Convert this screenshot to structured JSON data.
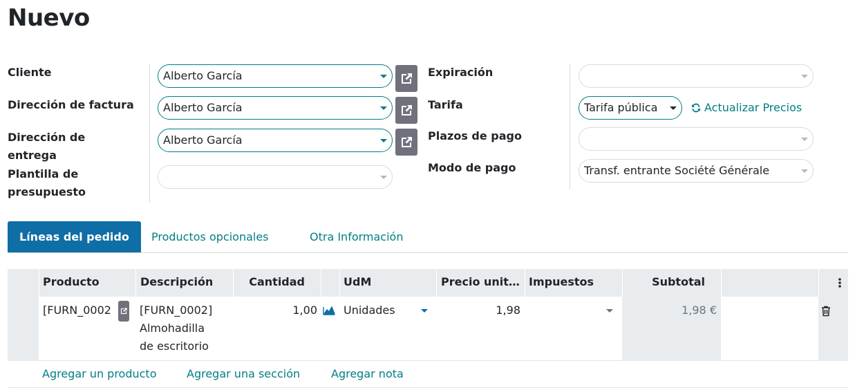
{
  "page": {
    "title": "Nuevo"
  },
  "form": {
    "left": {
      "cliente": {
        "label": "Cliente",
        "value": "Alberto García"
      },
      "direccion_factura": {
        "label": "Dirección de factura",
        "value": "Alberto García"
      },
      "direccion_entrega": {
        "label_line1": "Dirección de",
        "label_line2": "entrega",
        "value": "Alberto García"
      },
      "plantilla": {
        "label_line1": "Plantilla de",
        "label_line2": "presupuesto",
        "value": ""
      }
    },
    "right": {
      "expiracion": {
        "label": "Expiración",
        "value": ""
      },
      "tarifa": {
        "label": "Tarifa",
        "value": "Tarifa pública",
        "action": "Actualizar Precios"
      },
      "plazos": {
        "label": "Plazos de pago",
        "value": ""
      },
      "modo": {
        "label": "Modo de pago",
        "value": "Transf. entrante Société Générale"
      }
    }
  },
  "tabs": [
    {
      "label": "Líneas del pedido",
      "active": true
    },
    {
      "label": "Productos opcionales",
      "active": false
    },
    {
      "label": "Otra Información",
      "active": false
    }
  ],
  "table": {
    "columns": {
      "producto": "Producto",
      "descripcion": "Descripción",
      "cantidad": "Cantidad",
      "udm": "UdM",
      "precio": "Precio unit…",
      "impuestos": "Impuestos",
      "subtotal": "Subtotal"
    },
    "rows": [
      {
        "producto": "[FURN_0002]",
        "descripcion_line1": "[FURN_0002]",
        "descripcion_line2": "Almohadilla",
        "descripcion_line3": "de escritorio",
        "cantidad": "1,00",
        "udm": "Unidades",
        "precio": "1,98",
        "impuestos": "",
        "subtotal": "1,98 €"
      }
    ],
    "actions": {
      "add_product": "Agregar un producto",
      "add_section": "Agregar una sección",
      "add_note": "Agregar nota"
    }
  },
  "colors": {
    "accent": "#017e84",
    "tab_active": "#0f6ea6",
    "header_bg": "#e9ecef",
    "ext_button": "#71717d"
  },
  "icons": [
    "external-link-icon",
    "refresh-icon",
    "caret-down-icon",
    "forecast-chart-icon",
    "trash-icon",
    "kebab-menu-icon"
  ]
}
